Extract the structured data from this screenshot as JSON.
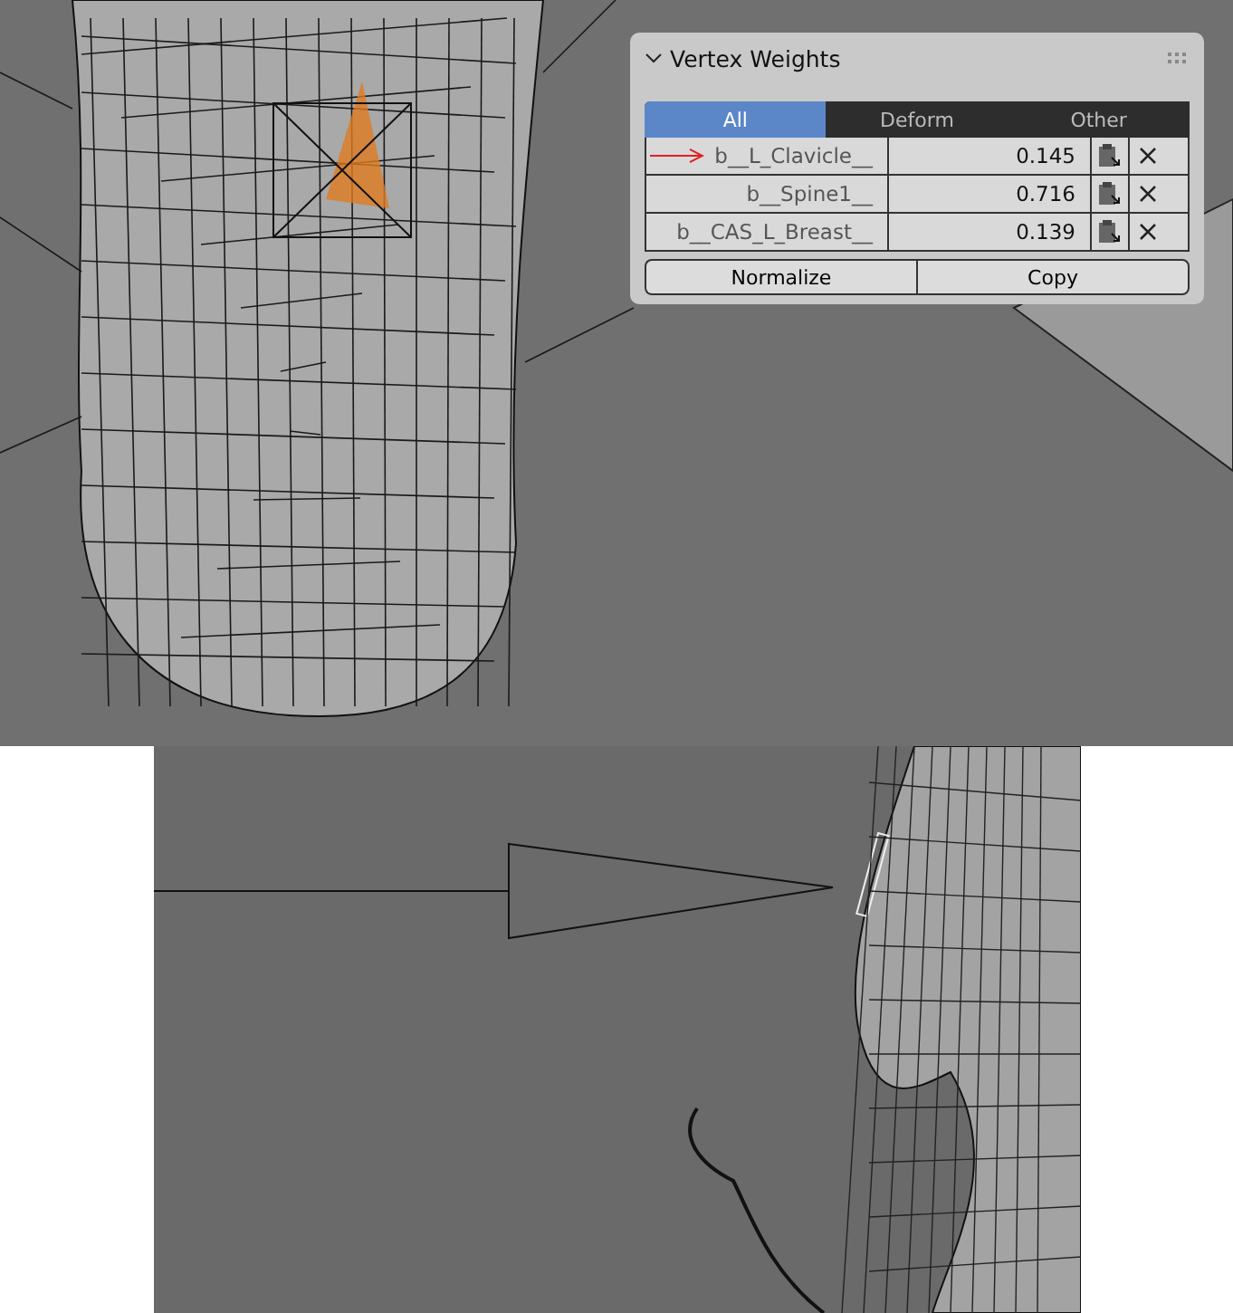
{
  "panel": {
    "title": "Vertex Weights",
    "expanded": true,
    "tabs": [
      {
        "label": "All",
        "selected": true
      },
      {
        "label": "Deform",
        "selected": false
      },
      {
        "label": "Other",
        "selected": false
      }
    ],
    "rows": [
      {
        "group": "b__L_Clavicle__",
        "weight": "0.145",
        "marked": true
      },
      {
        "group": "b__Spine1__",
        "weight": "0.716",
        "marked": false
      },
      {
        "group": "b__CAS_L_Breast__",
        "weight": "0.139",
        "marked": false
      }
    ],
    "buttons": [
      "Normalize",
      "Copy"
    ]
  }
}
